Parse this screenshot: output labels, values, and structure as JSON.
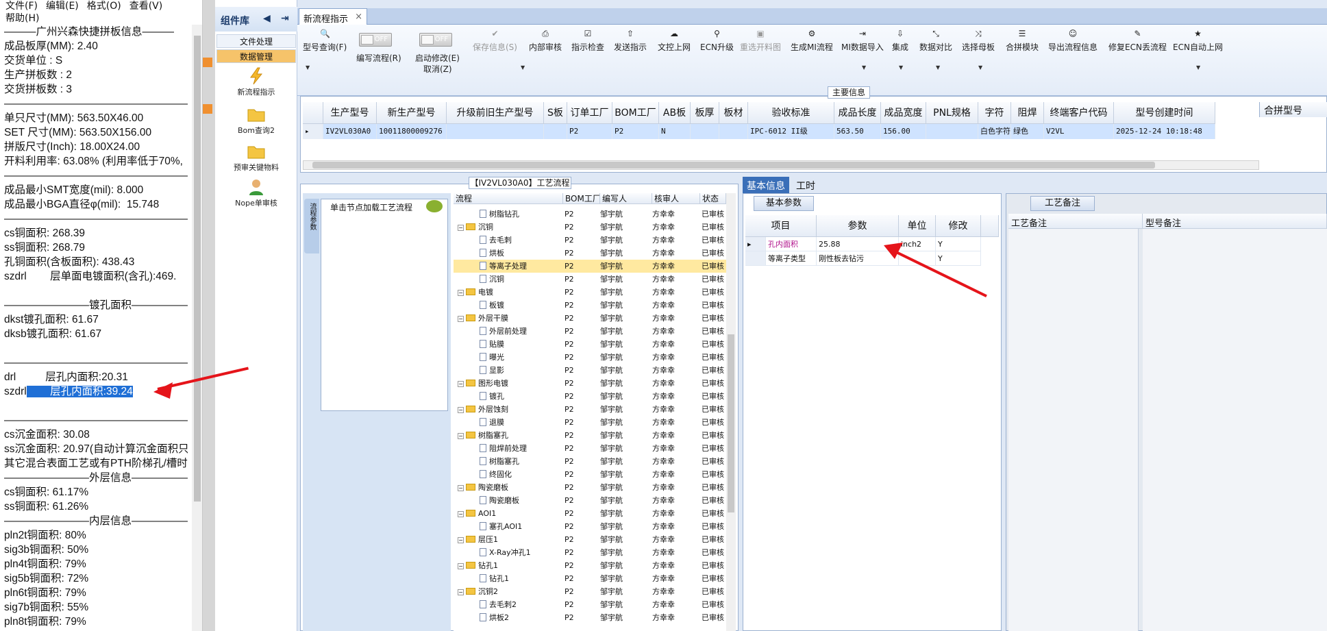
{
  "notepad": {
    "menu": [
      "文件(F)",
      "编辑(E)",
      "格式(O)",
      "查看(V)",
      "帮助(H)"
    ],
    "lines": [
      "———广州兴森快捷拼板信息———",
      "成品板厚(MM): 2.40",
      "交货单位 : S",
      "生产拼板数 : 2",
      "交货拼板数 : 3",
      "————————————————————",
      "单只尺寸(MM): 563.50X46.00",
      "SET 尺寸(MM): 563.50X156.00",
      "拼版尺寸(Inch): 18.00X24.00",
      "开料利用率: 63.08% (利用率低于70%,",
      "————————————————————",
      "成品最小SMT宽度(mil): 8.000",
      "成品最小BGA直径φ(mil):  15.748",
      "————————————————————",
      "cs铜面积: 268.39",
      "ss铜面积: 268.79",
      "孔铜面积(含板面积): 438.43",
      "szdrl        层单面电镀面积(含孔):469.",
      "",
      "————————镀孔面积————————",
      "dkst镀孔面积: 61.67",
      "dksb镀孔面积: 61.67",
      "",
      "————————————————————",
      "drl          层孔内面积:20.31",
      "szdrl        层孔内面积:39.24",
      "",
      "————————————————————",
      "cs沉金面积: 30.08",
      "ss沉金面积: 20.97(自动计算沉金面积只",
      "其它混合表面工艺或有PTH阶梯孔/槽时",
      "————————外层信息————————",
      "cs铜面积: 61.17%",
      "ss铜面积: 61.26%",
      "————————内层信息————————",
      "pln2t铜面积: 80%",
      "sig3b铜面积: 50%",
      "pln4t铜面积: 79%",
      "sig5b铜面积: 72%",
      "pln6t铜面积: 79%",
      "sig7b铜面积: 55%",
      "pln8t铜面积: 79%"
    ]
  },
  "component_panel": {
    "title": "组件库",
    "tabs": [
      "文件处理",
      "数据管理"
    ],
    "items": [
      "新流程指示",
      "Bom查询2",
      "预审关键物料",
      "Nope单审核"
    ]
  },
  "doc_tab": {
    "label": "新流程指示",
    "close": "×"
  },
  "toolbar": {
    "query": "型号查询(F)",
    "toggle1_state": "OFF",
    "toggle1_caption": "编写流程(R)",
    "toggle2_state": "OFF",
    "toggle2_caption": "启动修改(E)",
    "cancel": "取消(Z)",
    "buttons": [
      "保存信息(S)",
      "内部审核",
      "指示检查",
      "发送指示",
      "文控上网",
      "ECN升级",
      "重选开料图",
      "生成MI流程",
      "MI数据导入",
      "集成",
      "数据对比",
      "选择母板",
      "合拼模块",
      "导出流程信息",
      "修复ECN丢流程",
      "ECN自动上网"
    ]
  },
  "main_info": {
    "title": "主要信息",
    "columns": [
      "生产型号",
      "新生产型号",
      "升级前旧生产型号",
      "S板",
      "订单工厂",
      "BOM工厂",
      "AB板",
      "板厚",
      "板材",
      "验收标准",
      "成品长度",
      "成品宽度",
      "PNL规格",
      "字符",
      "阻焊",
      "终端客户代码",
      "型号创建时间"
    ],
    "row": [
      "IV2VL030A0",
      "10011800009276",
      "",
      "",
      "P2",
      "P2",
      "N",
      "",
      "",
      "IPC-6012 II级",
      "563.50",
      "156.00",
      "",
      "白色字符",
      "绿色",
      "V2VL",
      "2025-12-24 10:18:48"
    ],
    "merge_header": "合拼型号"
  },
  "flow": {
    "title": "【IV2VL030A0】工艺流程",
    "side_tab": "流程参数",
    "hint": "单击节点加载工艺流程",
    "columns": [
      "流程",
      "BOM工厂",
      "编写人",
      "核审人",
      "状态"
    ],
    "rows": [
      {
        "level": 1,
        "folder": false,
        "name": "树脂钻孔",
        "bom": "P2",
        "writer": "邹宇航",
        "reviewer": "方幸幸",
        "status": "已审核"
      },
      {
        "level": 0,
        "folder": true,
        "name": "沉铜",
        "bom": "P2",
        "writer": "邹宇航",
        "reviewer": "方幸幸",
        "status": "已审核"
      },
      {
        "level": 1,
        "folder": false,
        "name": "去毛刺",
        "bom": "P2",
        "writer": "邹宇航",
        "reviewer": "方幸幸",
        "status": "已审核"
      },
      {
        "level": 1,
        "folder": false,
        "name": "烘板",
        "bom": "P2",
        "writer": "邹宇航",
        "reviewer": "方幸幸",
        "status": "已审核"
      },
      {
        "level": 1,
        "folder": false,
        "name": "等离子处理",
        "bom": "P2",
        "writer": "邹宇航",
        "reviewer": "方幸幸",
        "status": "已审核",
        "selected": true
      },
      {
        "level": 1,
        "folder": false,
        "name": "沉铜",
        "bom": "P2",
        "writer": "邹宇航",
        "reviewer": "方幸幸",
        "status": "已审核"
      },
      {
        "level": 0,
        "folder": true,
        "name": "电镀",
        "bom": "P2",
        "writer": "邹宇航",
        "reviewer": "方幸幸",
        "status": "已审核"
      },
      {
        "level": 1,
        "folder": false,
        "name": "板镀",
        "bom": "P2",
        "writer": "邹宇航",
        "reviewer": "方幸幸",
        "status": "已审核"
      },
      {
        "level": 0,
        "folder": true,
        "name": "外层干膜",
        "bom": "P2",
        "writer": "邹宇航",
        "reviewer": "方幸幸",
        "status": "已审核"
      },
      {
        "level": 1,
        "folder": false,
        "name": "外层前处理",
        "bom": "P2",
        "writer": "邹宇航",
        "reviewer": "方幸幸",
        "status": "已审核"
      },
      {
        "level": 1,
        "folder": false,
        "name": "贴膜",
        "bom": "P2",
        "writer": "邹宇航",
        "reviewer": "方幸幸",
        "status": "已审核"
      },
      {
        "level": 1,
        "folder": false,
        "name": "曝光",
        "bom": "P2",
        "writer": "邹宇航",
        "reviewer": "方幸幸",
        "status": "已审核"
      },
      {
        "level": 1,
        "folder": false,
        "name": "显影",
        "bom": "P2",
        "writer": "邹宇航",
        "reviewer": "方幸幸",
        "status": "已审核"
      },
      {
        "level": 0,
        "folder": true,
        "name": "图形电镀",
        "bom": "P2",
        "writer": "邹宇航",
        "reviewer": "方幸幸",
        "status": "已审核"
      },
      {
        "level": 1,
        "folder": false,
        "name": "镀孔",
        "bom": "P2",
        "writer": "邹宇航",
        "reviewer": "方幸幸",
        "status": "已审核"
      },
      {
        "level": 0,
        "folder": true,
        "name": "外层蚀刻",
        "bom": "P2",
        "writer": "邹宇航",
        "reviewer": "方幸幸",
        "status": "已审核"
      },
      {
        "level": 1,
        "folder": false,
        "name": "退膜",
        "bom": "P2",
        "writer": "邹宇航",
        "reviewer": "方幸幸",
        "status": "已审核"
      },
      {
        "level": 0,
        "folder": true,
        "name": "树脂塞孔",
        "bom": "P2",
        "writer": "邹宇航",
        "reviewer": "方幸幸",
        "status": "已审核"
      },
      {
        "level": 1,
        "folder": false,
        "name": "阻焊前处理",
        "bom": "P2",
        "writer": "邹宇航",
        "reviewer": "方幸幸",
        "status": "已审核"
      },
      {
        "level": 1,
        "folder": false,
        "name": "树脂塞孔",
        "bom": "P2",
        "writer": "邹宇航",
        "reviewer": "方幸幸",
        "status": "已审核"
      },
      {
        "level": 1,
        "folder": false,
        "name": "终固化",
        "bom": "P2",
        "writer": "邹宇航",
        "reviewer": "方幸幸",
        "status": "已审核"
      },
      {
        "level": 0,
        "folder": true,
        "name": "陶瓷磨板",
        "bom": "P2",
        "writer": "邹宇航",
        "reviewer": "方幸幸",
        "status": "已审核"
      },
      {
        "level": 1,
        "folder": false,
        "name": "陶瓷磨板",
        "bom": "P2",
        "writer": "邹宇航",
        "reviewer": "方幸幸",
        "status": "已审核"
      },
      {
        "level": 0,
        "folder": true,
        "name": "AOI1",
        "bom": "P2",
        "writer": "邹宇航",
        "reviewer": "方幸幸",
        "status": "已审核"
      },
      {
        "level": 1,
        "folder": false,
        "name": "塞孔AOI1",
        "bom": "P2",
        "writer": "邹宇航",
        "reviewer": "方幸幸",
        "status": "已审核"
      },
      {
        "level": 0,
        "folder": true,
        "name": "层压1",
        "bom": "P2",
        "writer": "邹宇航",
        "reviewer": "方幸幸",
        "status": "已审核"
      },
      {
        "level": 1,
        "folder": false,
        "name": "X-Ray冲孔1",
        "bom": "P2",
        "writer": "邹宇航",
        "reviewer": "方幸幸",
        "status": "已审核"
      },
      {
        "level": 0,
        "folder": true,
        "name": "钻孔1",
        "bom": "P2",
        "writer": "邹宇航",
        "reviewer": "方幸幸",
        "status": "已审核"
      },
      {
        "level": 1,
        "folder": false,
        "name": "钻孔1",
        "bom": "P2",
        "writer": "邹宇航",
        "reviewer": "方幸幸",
        "status": "已审核"
      },
      {
        "level": 0,
        "folder": true,
        "name": "沉铜2",
        "bom": "P2",
        "writer": "邹宇航",
        "reviewer": "方幸幸",
        "status": "已审核"
      },
      {
        "level": 1,
        "folder": false,
        "name": "去毛刺2",
        "bom": "P2",
        "writer": "邹宇航",
        "reviewer": "方幸幸",
        "status": "已审核"
      },
      {
        "level": 1,
        "folder": false,
        "name": "烘板2",
        "bom": "P2",
        "writer": "邹宇航",
        "reviewer": "方幸幸",
        "status": "已审核"
      }
    ]
  },
  "right_panel": {
    "tabs": [
      "基本信息",
      "工时"
    ],
    "basic_tab": "基本参数",
    "columns": [
      "项目",
      "参数",
      "单位",
      "修改"
    ],
    "rows": [
      {
        "item": "孔内面积",
        "param": "25.88",
        "unit": "inch2",
        "mod": "Y"
      },
      {
        "item": "等离子类型",
        "param": "刚性板去钻污",
        "unit": "",
        "mod": "Y"
      }
    ],
    "note_tab": "工艺备注",
    "note_columns": [
      "工艺备注",
      "型号备注"
    ]
  },
  "colors": {
    "annotation_arrow": "#e5141a",
    "selection": "#1f6fd6",
    "row_highlight": "#ffe9a0"
  }
}
